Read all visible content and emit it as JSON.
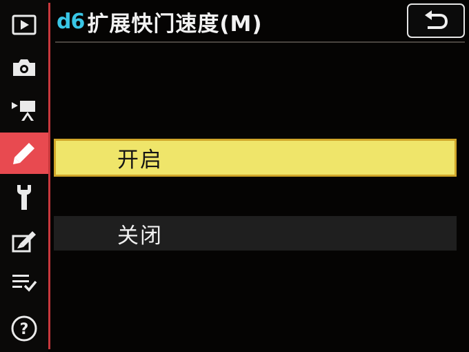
{
  "header": {
    "menu_code": "d6",
    "title": "扩展快门速度(M)"
  },
  "rail": {
    "items": [
      {
        "icon": "playback-icon",
        "active": false
      },
      {
        "icon": "camera-icon",
        "active": false
      },
      {
        "icon": "movie-camera-icon",
        "active": false
      },
      {
        "icon": "pencil-icon",
        "active": true
      },
      {
        "icon": "wrench-icon",
        "active": false
      },
      {
        "icon": "retouch-icon",
        "active": false
      },
      {
        "icon": "my-menu-icon",
        "active": false
      },
      {
        "icon": "help-icon",
        "active": false
      }
    ]
  },
  "options": [
    {
      "label": "开启",
      "selected": true
    },
    {
      "label": "关闭",
      "selected": false
    }
  ],
  "colors": {
    "accent_red": "#e84a50",
    "menu_code_cyan": "#39c6e6",
    "selection_yellow": "#efe56a",
    "selection_border": "#d0a629"
  }
}
